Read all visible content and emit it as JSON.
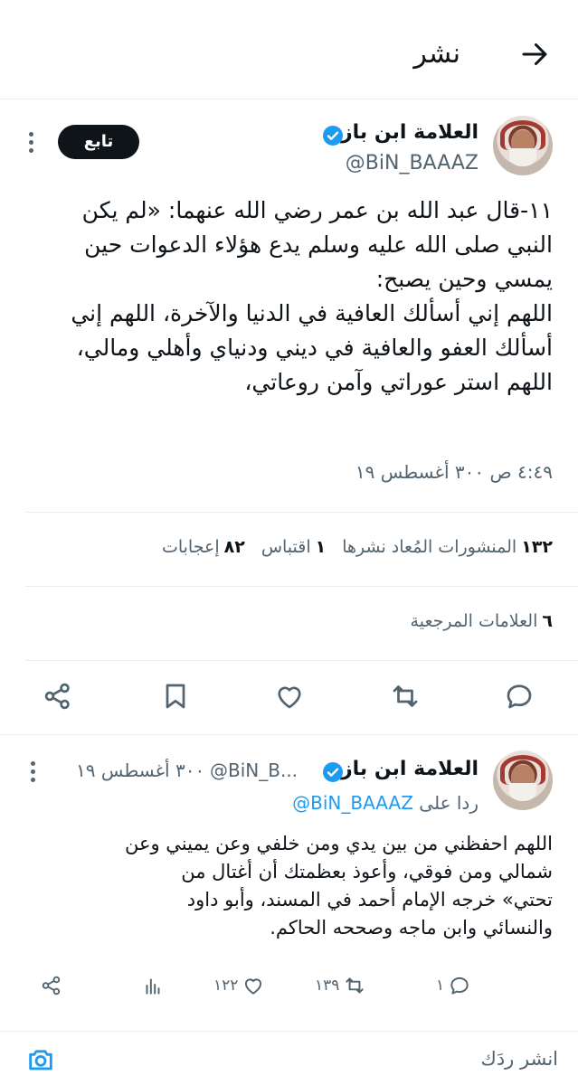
{
  "header": {
    "title": "نشر"
  },
  "tweet": {
    "author_name": "العلامة ابن باز",
    "handle": "@BiN_BAAAZ",
    "follow_label": "تابع",
    "text": "١١-قال عبد الله بن عمر رضي الله عنهما: «لم يكن\nالنبي صلى الله عليه وسلم يدع هؤلاء الدعوات حين\nيمسي وحين يصبح:\nاللهم إني أسألك العافية في الدنيا والآخرة، اللهم إني\nأسألك العفو والعافية في ديني ودنياي وأهلي ومالي،\nاللهم استر عوراتي وآمن روعاتي،",
    "timestamp": "٤:٤٩ ص ٣٠٠ أغسطس ١٩",
    "stats": {
      "reposts_count": "١٣٢",
      "reposts_label": "المنشورات المُعاد نشرها",
      "quotes_count": "١",
      "quotes_label": "اقتباس",
      "likes_count": "٨٢",
      "likes_label": "إعجابات",
      "bookmarks_count": "٦",
      "bookmarks_label": "العلامات المرجعية"
    },
    "actions": [
      "reply-icon",
      "retweet-icon",
      "like-icon",
      "bookmark-icon",
      "share-icon"
    ]
  },
  "reply": {
    "author_name": "العلامة ابن باز",
    "handle_truncated": "@BiN_B...",
    "date": "٣٠٠ أغسطس ١٩",
    "replying_to_label": "ردا على",
    "replying_to_handle": "@BiN_BAAAZ",
    "text": "اللهم احفظني من بين يدي ومن خلفي وعن يميني وعن\nشمالي ومن فوقي، وأعوذ بعظمتك أن أغتال من\nتحتي» خرجه الإمام أحمد في المسند، وأبو داود\nوالنسائي وابن ماجه وصححه الحاكم.",
    "counts": {
      "replies": "١",
      "retweets": "١٣٩",
      "likes": "١٢٢"
    }
  },
  "compose": {
    "placeholder": "انشر ردَك"
  },
  "colors": {
    "accent": "#1d9bf0",
    "text": "#0f1419",
    "secondary": "#536471",
    "divider": "#e6ecf0"
  }
}
